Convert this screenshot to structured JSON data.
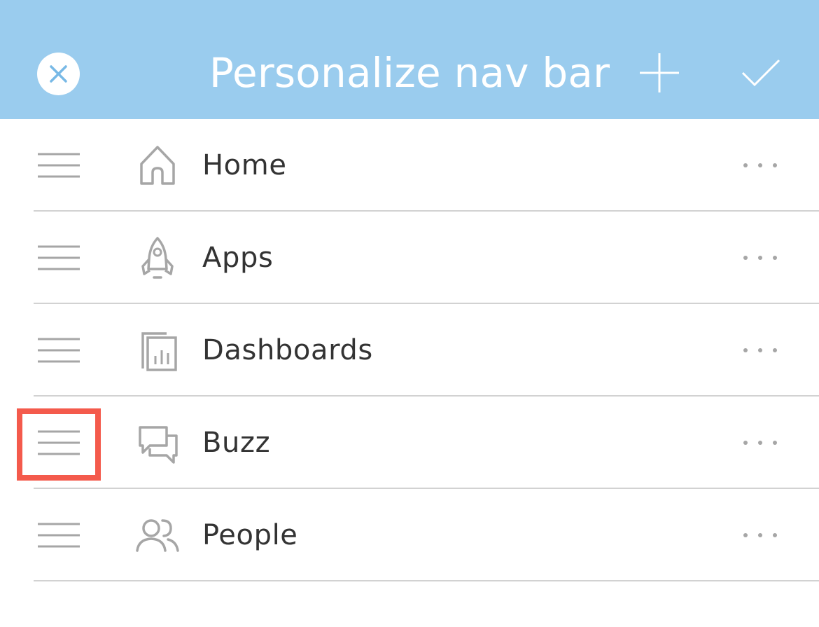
{
  "header": {
    "title": "Personalize nav bar",
    "background_color": "#9accee",
    "close_icon": "close-icon",
    "add_icon": "plus-icon",
    "done_icon": "checkmark-icon"
  },
  "nav_items": [
    {
      "label": "Home",
      "icon": "home-icon"
    },
    {
      "label": "Apps",
      "icon": "rocket-icon"
    },
    {
      "label": "Dashboards",
      "icon": "dashboard-icon"
    },
    {
      "label": "Buzz",
      "icon": "chat-bubbles-icon"
    },
    {
      "label": "People",
      "icon": "people-icon"
    }
  ],
  "row_controls": {
    "drag_icon": "drag-handle-icon",
    "more_icon": "more-icon"
  },
  "highlight": {
    "target": "Buzz",
    "color": "#f45a4c"
  }
}
